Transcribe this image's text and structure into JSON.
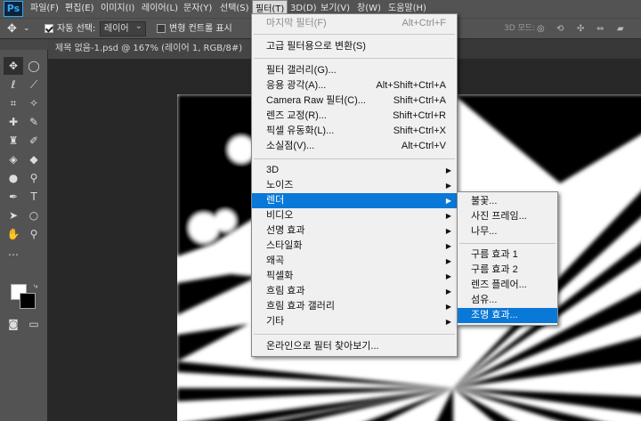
{
  "app": {
    "logo": "Ps"
  },
  "menubar": [
    {
      "label": "파일(F)",
      "active": false
    },
    {
      "label": "편집(E)",
      "active": false
    },
    {
      "label": "이미지(I)",
      "active": false
    },
    {
      "label": "레이어(L)",
      "active": false
    },
    {
      "label": "문자(Y)",
      "active": false
    },
    {
      "label": "선택(S)",
      "active": false
    },
    {
      "label": "필터(T)",
      "active": true
    },
    {
      "label": "3D(D)",
      "active": false
    },
    {
      "label": "보기(V)",
      "active": false
    },
    {
      "label": "창(W)",
      "active": false
    },
    {
      "label": "도움말(H)",
      "active": false
    }
  ],
  "options": {
    "auto_select_label": "자동 선택:",
    "auto_select_value": "레이어",
    "transform_controls_label": "변형 컨트롤 표시",
    "mode_3d_label": "3D 모드:"
  },
  "document_tab": {
    "label": "제목 없음-1.psd @ 167% (레이어 1, RGB/8#)"
  },
  "filter_menu": {
    "last_filter": {
      "label": "마지막 필터(F)",
      "shortcut": "Alt+Ctrl+F"
    },
    "convert_smart": {
      "label": "고급 필터용으로 변환(S)"
    },
    "items_group2": [
      {
        "label": "필터 갤러리(G)...",
        "shortcut": ""
      },
      {
        "label": "응용 광각(A)...",
        "shortcut": "Alt+Shift+Ctrl+A"
      },
      {
        "label": "Camera Raw 필터(C)...",
        "shortcut": "Shift+Ctrl+A"
      },
      {
        "label": "렌즈 교정(R)...",
        "shortcut": "Shift+Ctrl+R"
      },
      {
        "label": "픽셀 유동화(L)...",
        "shortcut": "Shift+Ctrl+X"
      },
      {
        "label": "소실점(V)...",
        "shortcut": "Alt+Ctrl+V"
      }
    ],
    "submenus": [
      {
        "label": "3D",
        "highlighted": false
      },
      {
        "label": "노이즈",
        "highlighted": false
      },
      {
        "label": "렌더",
        "highlighted": true
      },
      {
        "label": "비디오",
        "highlighted": false
      },
      {
        "label": "선명 효과",
        "highlighted": false
      },
      {
        "label": "스타일화",
        "highlighted": false
      },
      {
        "label": "왜곡",
        "highlighted": false
      },
      {
        "label": "픽셀화",
        "highlighted": false
      },
      {
        "label": "흐림 효과",
        "highlighted": false
      },
      {
        "label": "흐림 효과 갤러리",
        "highlighted": false
      },
      {
        "label": "기타",
        "highlighted": false
      }
    ],
    "online": {
      "label": "온라인으로 필터 찾아보기..."
    }
  },
  "render_menu": {
    "group1": [
      "불꽃...",
      "사진 프레임...",
      "나무..."
    ],
    "group2": [
      "구름 효과 1",
      "구름 효과 2",
      "렌즈 플레어...",
      "섬유...",
      "조명 효과..."
    ],
    "highlighted": "조명 효과..."
  },
  "colors": {
    "accent": "#0a78d7",
    "panel": "#535353",
    "menu_bg": "#f0f0f0"
  }
}
